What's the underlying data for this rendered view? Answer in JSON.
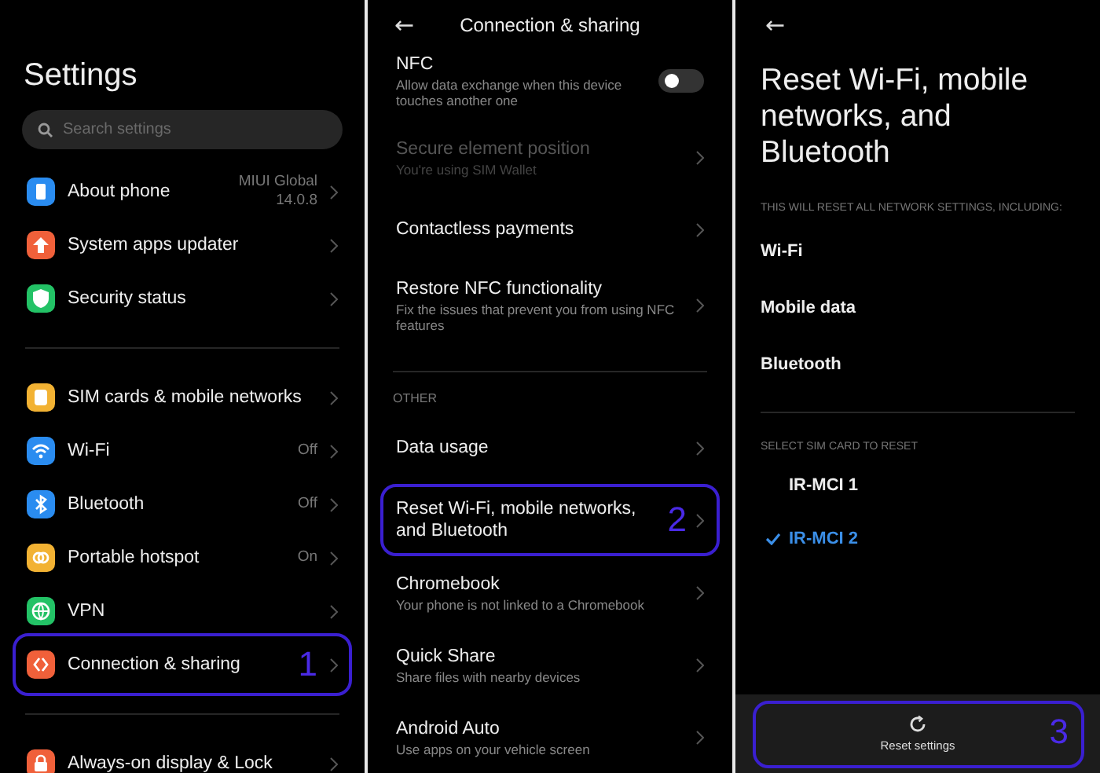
{
  "settings": {
    "title": "Settings",
    "search": {
      "placeholder": "Search settings"
    },
    "groups": [
      [
        {
          "label": "About phone",
          "value": "MIUI Global\n14.0.8",
          "color": "#2a8cf0"
        },
        {
          "label": "System apps updater",
          "color": "#f0603a"
        },
        {
          "label": "Security status",
          "color": "#23c266"
        }
      ],
      [
        {
          "label": "SIM cards & mobile networks",
          "color": "#f2b233"
        },
        {
          "label": "Wi-Fi",
          "value": "Off",
          "color": "#2a8cf0"
        },
        {
          "label": "Bluetooth",
          "value": "Off",
          "color": "#2a8cf0"
        },
        {
          "label": "Portable hotspot",
          "value": "On",
          "color": "#f2b233"
        },
        {
          "label": "VPN",
          "color": "#23c266"
        },
        {
          "label": "Connection & sharing",
          "color": "#f0603a",
          "marker": "1"
        }
      ],
      [
        {
          "label": "Always-on display & Lock",
          "color": "#f0603a"
        }
      ]
    ]
  },
  "connection": {
    "back": "←",
    "title": "Connection & sharing",
    "sections": [
      {
        "items": [
          {
            "kind": "toggle",
            "title": "NFC",
            "subtitle": "Allow data exchange when this device touches another one",
            "on": false
          },
          {
            "kind": "link",
            "title": "Secure element position",
            "subtitle": "You're using SIM  Wallet",
            "disabled": true
          },
          {
            "kind": "link",
            "title": "Contactless payments",
            "disabled": false
          },
          {
            "kind": "link",
            "title": "Restore NFC functionality",
            "subtitle": "Fix the issues that prevent you from using NFC features",
            "disabled": false
          }
        ]
      },
      {
        "header": "OTHER",
        "items": [
          {
            "kind": "link",
            "title": "Data usage",
            "disabled": false
          },
          {
            "kind": "link",
            "title": "Reset Wi-Fi, mobile networks, and Bluetooth",
            "disabled": false,
            "marker": "2"
          },
          {
            "kind": "link",
            "title": "Chromebook",
            "subtitle": "Your phone is not linked to a Chromebook",
            "disabled": false
          },
          {
            "kind": "link",
            "title": "Quick Share",
            "subtitle": "Share files with nearby devices",
            "disabled": false
          },
          {
            "kind": "link",
            "title": "Android Auto",
            "subtitle": "Use apps on your vehicle screen",
            "disabled": false
          }
        ]
      }
    ]
  },
  "reset": {
    "back": "←",
    "title": "Reset Wi-Fi, mobile networks, and Bluetooth",
    "caption": "THIS WILL RESET ALL NETWORK SETTINGS, INCLUDING:",
    "includes": [
      "Wi-Fi",
      "Mobile data",
      "Bluetooth"
    ],
    "sim_caption": "SELECT SIM CARD TO RESET",
    "sims": [
      {
        "label": "IR-MCI 1",
        "selected": false
      },
      {
        "label": "IR-MCI 2",
        "selected": true
      }
    ],
    "button": {
      "label": "Reset settings",
      "marker": "3"
    }
  }
}
